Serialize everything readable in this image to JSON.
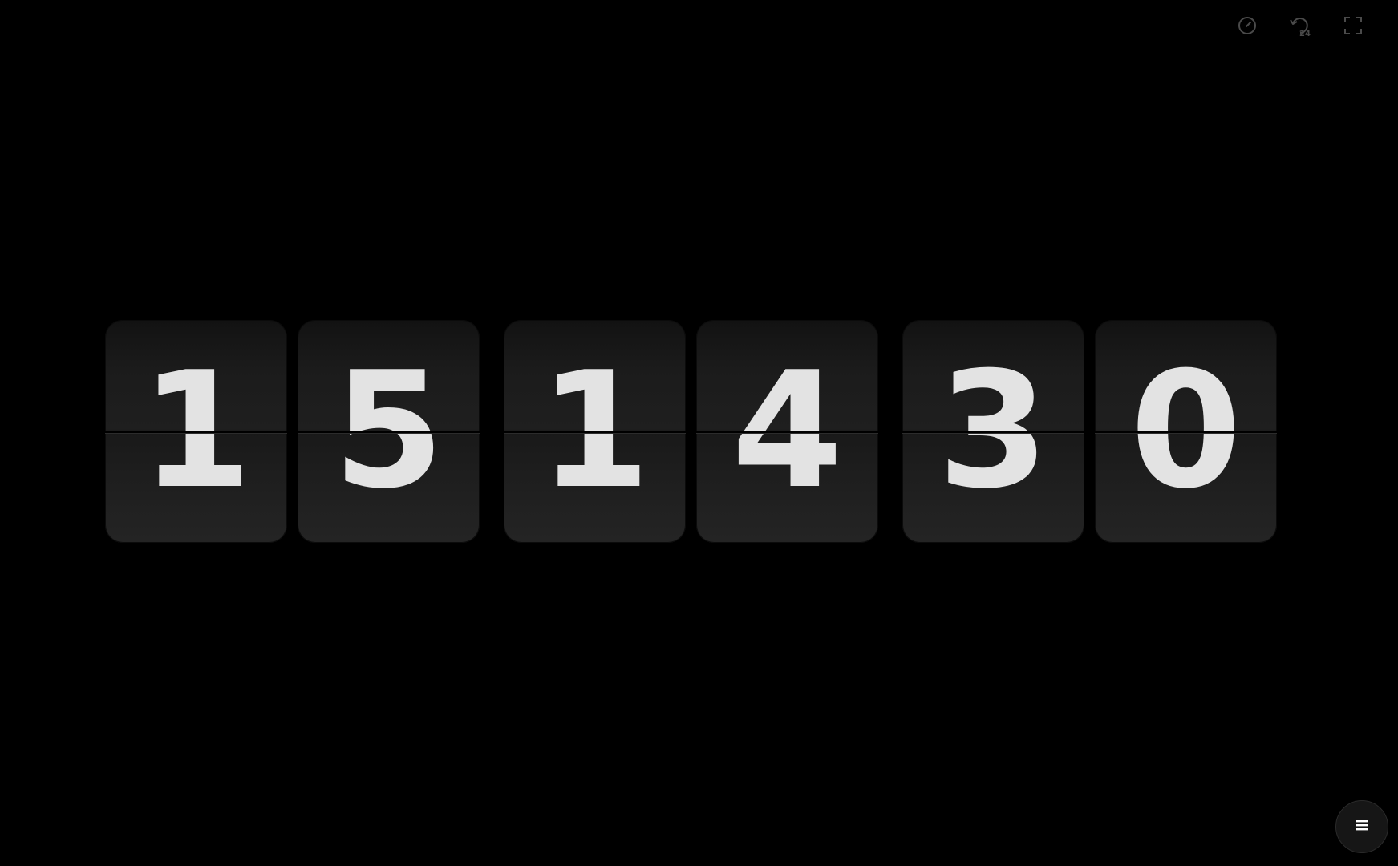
{
  "clock": {
    "digits": {
      "hour_tens": "1",
      "hour_ones": "5",
      "minute_tens": "1",
      "minute_ones": "4",
      "second_tens": "3",
      "second_ones": "0"
    },
    "digit_color": "#e3e3e3",
    "card_color": "#1e1e1e"
  },
  "toolbar": {
    "icons": [
      "speedometer-icon",
      "24-hour-toggle-icon",
      "fullscreen-icon"
    ],
    "toggle_badge": "24",
    "icon_color": "#4a4a4a"
  },
  "menu_button": {
    "icon": "hamburger-menu-icon"
  },
  "background_color": "#000000"
}
